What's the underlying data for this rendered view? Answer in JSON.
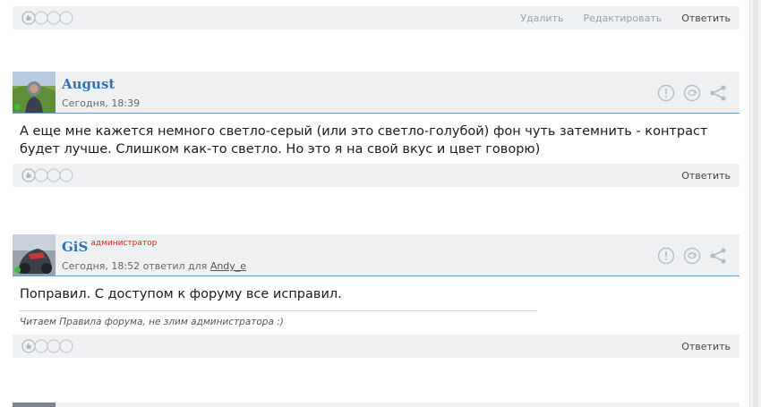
{
  "top_post": {
    "actions": {
      "delete": "Удалить",
      "edit": "Редактировать",
      "reply": "Ответить"
    }
  },
  "posts": [
    {
      "author": "August",
      "role": "",
      "time": "Сегодня, 18:39",
      "reply_to_prefix": "",
      "reply_to": "",
      "text": "А еще мне кажется немного светло-серый (или это светло-голубой) фон чуть затемнить - контраст будет лучше. Слишком как-то светло. Но это я на свой вкус и цвет говорю)",
      "reply": "Ответить"
    },
    {
      "author": "GiS",
      "role": "администратор",
      "time": "Сегодня, 18:52",
      "reply_to_prefix": "ответил для",
      "reply_to": "Andy_e",
      "text": "Поправил. С доступом к форуму все исправил.",
      "signature": "Читаем Правила форума, не злим администратора :)",
      "reply": "Ответить"
    }
  ],
  "colors": {
    "accent": "#2e74b5",
    "role": "#e01919",
    "bar": "#f0f1f3",
    "divider": "#6f9ac7"
  },
  "icons": [
    "like-icon",
    "report-icon",
    "quote-icon",
    "share-icon",
    "online-indicator"
  ]
}
